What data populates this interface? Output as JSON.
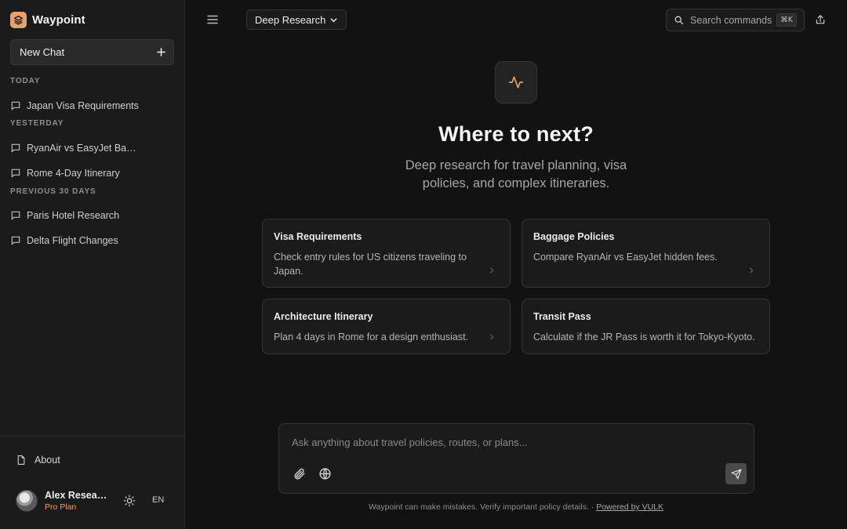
{
  "app": {
    "name": "Waypoint"
  },
  "sidebar": {
    "new_chat_label": "New Chat",
    "sections": [
      {
        "heading": "TODAY",
        "items": [
          "Japan Visa Requirements"
        ]
      },
      {
        "heading": "YESTERDAY",
        "items": [
          "RyanAir vs EasyJet Baggage Policies",
          "Rome 4-Day Itinerary"
        ]
      },
      {
        "heading": "PREVIOUS 30 DAYS",
        "items": [
          "Paris Hotel Research",
          "Delta Flight Changes"
        ]
      }
    ],
    "about_label": "About",
    "user": {
      "name": "Alex Researcher",
      "plan": "Pro Plan"
    },
    "language": "EN"
  },
  "header": {
    "mode": "Deep Research",
    "search_placeholder": "Search commands",
    "search_shortcut": "⌘K"
  },
  "hero": {
    "title": "Where to next?",
    "subtitle": "Deep research for travel planning, visa policies, and complex itineraries."
  },
  "cards": [
    {
      "title": "Visa Requirements",
      "description": "Check entry rules for US citizens traveling to Japan."
    },
    {
      "title": "Baggage Policies",
      "description": "Compare RyanAir vs EasyJet hidden fees."
    },
    {
      "title": "Architecture Itinerary",
      "description": "Plan 4 days in Rome for a design enthusiast."
    },
    {
      "title": "Transit Pass",
      "description": "Calculate if the JR Pass is worth it for Tokyo-Kyoto."
    }
  ],
  "composer": {
    "placeholder": "Ask anything about travel policies, routes, or plans..."
  },
  "footer": {
    "disclaimer": "Waypoint can make mistakes. Verify important policy details. · ",
    "link_label": "Powered by VULK"
  },
  "colors": {
    "background": "#121212",
    "sidebar": "#1b1b1b",
    "accent": "#e9a06c",
    "border": "#353535"
  }
}
